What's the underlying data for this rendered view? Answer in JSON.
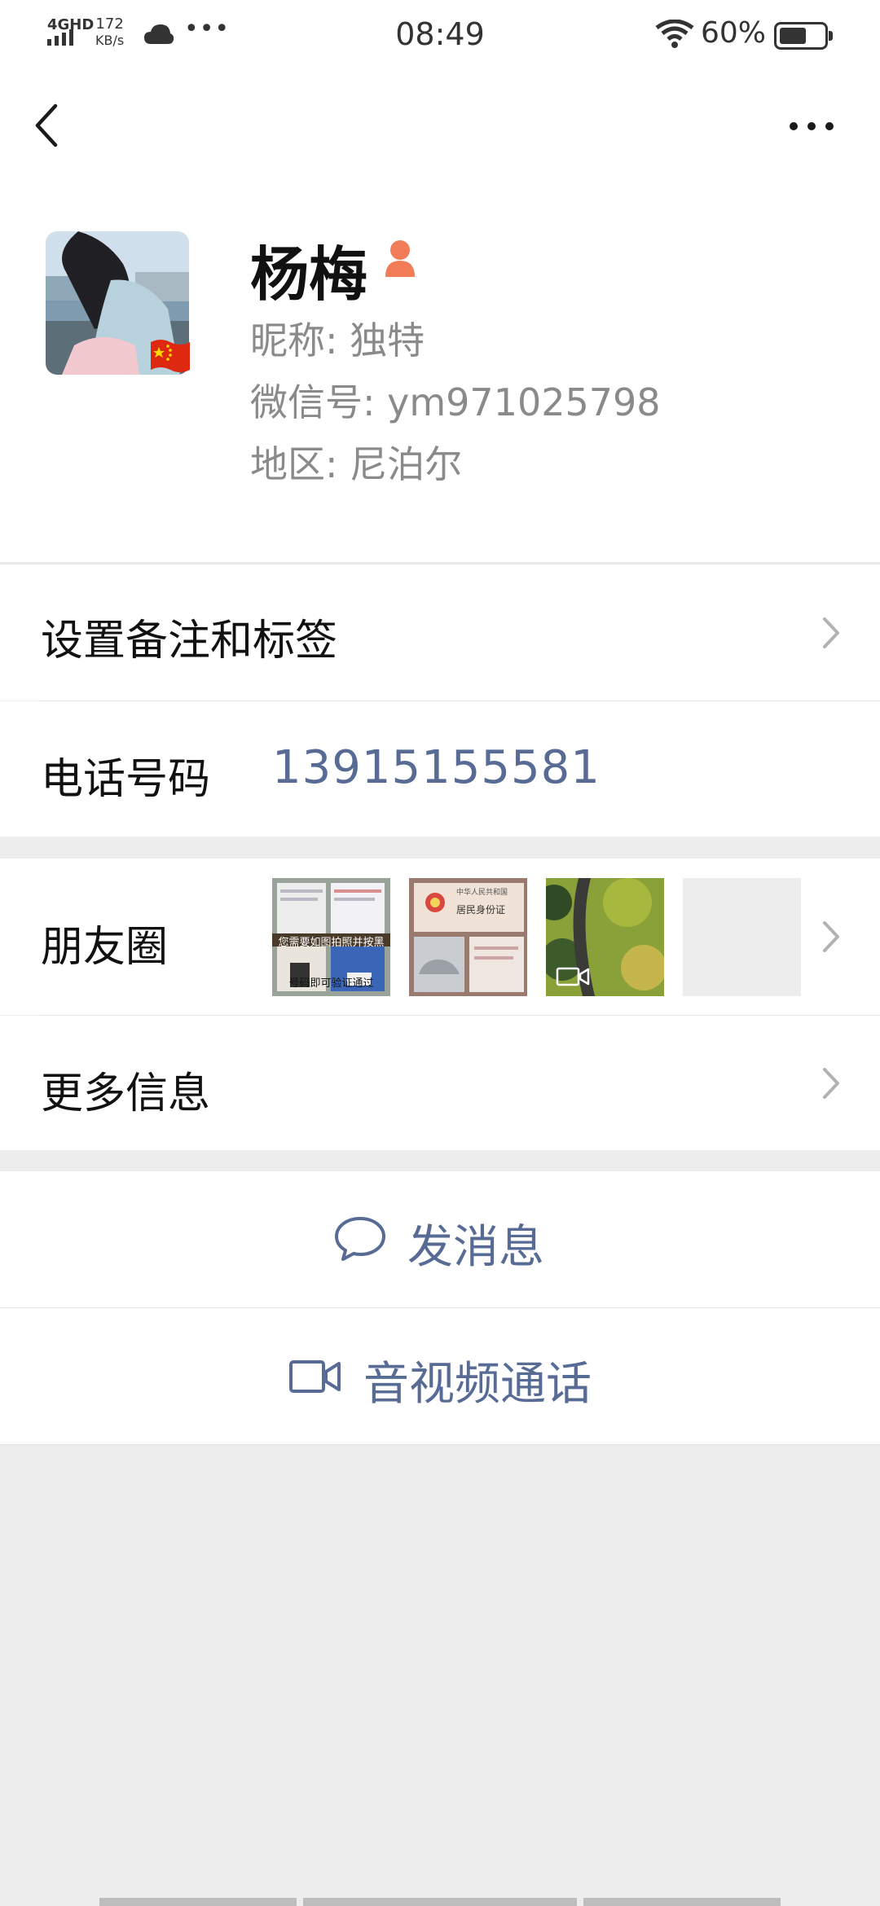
{
  "status_bar": {
    "network": "4GHD",
    "speed_value": "172",
    "speed_unit": "KB/s",
    "time": "08:49",
    "battery": "60%"
  },
  "profile": {
    "name": "杨梅",
    "nickname_label": "昵称:",
    "nickname": "独特",
    "wechat_id_label": "微信号:",
    "wechat_id": "ym971025798",
    "region_label": "地区:",
    "region": "尼泊尔"
  },
  "rows": {
    "remark_tags": "设置备注和标签",
    "phone_label": "电话号码",
    "phone_value": "13915155581",
    "moments": "朋友圈",
    "more_info": "更多信息"
  },
  "moments_thumbs": {
    "thumb1_line1": "您需要如图拍照并按黑",
    "thumb1_line2": "号码即可验证通过",
    "thumb2_header": "中华人民共和国",
    "thumb2_title": "居民身份证"
  },
  "actions": {
    "send_message": "发消息",
    "video_call": "音视频通话"
  },
  "colors": {
    "link_blue": "#576b95",
    "background": "#ededed",
    "badge": "#f07d58"
  }
}
